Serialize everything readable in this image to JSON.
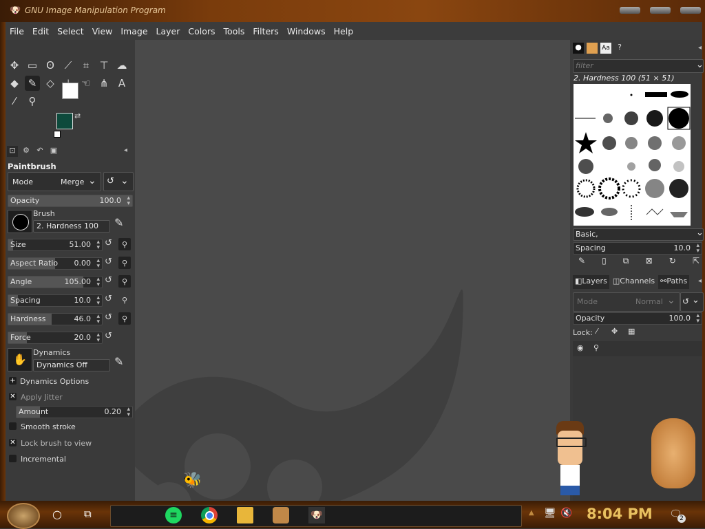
{
  "window": {
    "title": "GNU Image Manipulation Program"
  },
  "menubar": [
    "File",
    "Edit",
    "Select",
    "View",
    "Image",
    "Layer",
    "Colors",
    "Tools",
    "Filters",
    "Windows",
    "Help"
  ],
  "tool_options": {
    "title": "Paintbrush",
    "mode_label": "Mode",
    "mode_value": "Merge",
    "opacity": {
      "label": "Opacity",
      "value": "100.0",
      "level": 1.0
    },
    "brush_label": "Brush",
    "brush_value": "2. Hardness 100",
    "size": {
      "label": "Size",
      "value": "51.00",
      "level": 0.05
    },
    "aspect": {
      "label": "Aspect Ratio",
      "value": "0.00",
      "level": 0.5
    },
    "angle": {
      "label": "Angle",
      "value": "105.00",
      "level": 0.8
    },
    "spacing": {
      "label": "Spacing",
      "value": "10.0",
      "level": 0.1
    },
    "hardness": {
      "label": "Hardness",
      "value": "46.0",
      "level": 0.46
    },
    "force": {
      "label": "Force",
      "value": "20.0",
      "level": 0.2
    },
    "dynamics_label": "Dynamics",
    "dynamics_value": "Dynamics Off",
    "dynamics_options": "Dynamics Options",
    "apply_jitter": "Apply Jitter",
    "amount": {
      "label": "Amount",
      "value": "0.20",
      "level": 0.2
    },
    "smooth_stroke": "Smooth stroke",
    "lock_brush": "Lock brush to view",
    "incremental": "Incremental"
  },
  "brushes_panel": {
    "filter_placeholder": "filter",
    "current": "2. Hardness 100 (51 × 51)",
    "tag": "Basic,",
    "spacing_label": "Spacing",
    "spacing_value": "10.0"
  },
  "layers_panel": {
    "tabs": [
      "Layers",
      "Channels",
      "Paths"
    ],
    "mode_label": "Mode",
    "mode_value": "Normal",
    "opacity_label": "Opacity",
    "opacity_value": "100.0",
    "lock_label": "Lock:"
  },
  "taskbar": {
    "time": "8:04 PM",
    "notif_count": "2"
  },
  "colors": {
    "foreground": "#0d4a3c",
    "background": "#ffffff",
    "time_color": "#e8c060"
  }
}
